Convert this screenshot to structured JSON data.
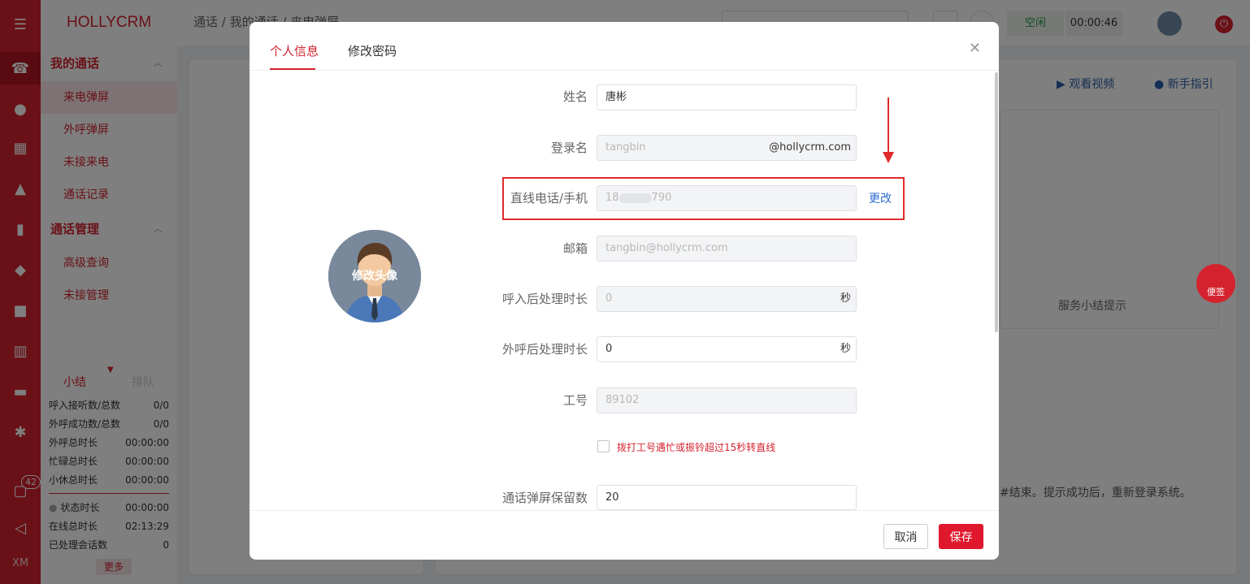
{
  "app": {
    "brand": "HOLLYCRM",
    "rail_footer": "XM",
    "badge_count": "42"
  },
  "breadcrumb": {
    "text": "通话 / 我的通话 / 来电弹屏"
  },
  "topbar": {
    "status": "空闲",
    "timer": "00:00:46"
  },
  "sidebar": {
    "groups": [
      {
        "label": "我的通话",
        "items": [
          "来电弹屏",
          "外呼弹屏",
          "未接来电",
          "通话记录"
        ]
      },
      {
        "label": "通话管理",
        "items": [
          "高级查询",
          "未接管理"
        ]
      }
    ]
  },
  "stats": {
    "tab_summary": "小结",
    "tab_queue": "排队",
    "rows": [
      {
        "label": "呼入接听数/总数",
        "value": "0/0"
      },
      {
        "label": "外呼成功数/总数",
        "value": "0/0"
      },
      {
        "label": "外呼总时长",
        "value": "00:00:00"
      },
      {
        "label": "忙碌总时长",
        "value": "00:00:00"
      },
      {
        "label": "小休总时长",
        "value": "00:00:00"
      }
    ],
    "rows2": [
      {
        "label": "状态时长",
        "value": "00:00:00"
      },
      {
        "label": "在线总时长",
        "value": "02:13:29"
      },
      {
        "label": "已处理会话数",
        "value": "0"
      }
    ],
    "more": "更多"
  },
  "background": {
    "video_link": "观看视频",
    "guide_link": "新手指引",
    "service_tip": "服务小结提示",
    "note": "#结束。提示成功后，重新登录系统。",
    "float_note": "便签"
  },
  "modal": {
    "tabs": [
      "个人信息",
      "修改密码"
    ],
    "avatar_label": "修改头像",
    "fields": {
      "name": {
        "label": "姓名",
        "value": "唐彬"
      },
      "login": {
        "label": "登录名",
        "value": "tangbin",
        "suffix": "@hollycrm.com"
      },
      "phone": {
        "label": "直线电话/手机",
        "prefix": "18",
        "suffix": "790",
        "action": "更改"
      },
      "email": {
        "label": "邮箱",
        "value": "tangbin@hollycrm.com"
      },
      "in_after": {
        "label": "呼入后处理时长",
        "value": "0",
        "unit": "秒"
      },
      "out_after": {
        "label": "外呼后处理时长",
        "value": "0",
        "unit": "秒"
      },
      "job_no": {
        "label": "工号",
        "value": "89102"
      },
      "popup_keep": {
        "label": "通话弹屏保留数",
        "value": "20"
      }
    },
    "checkbox_label": "拨打工号遇忙或振铃超过15秒转直线",
    "cancel": "取消",
    "save": "保存"
  }
}
